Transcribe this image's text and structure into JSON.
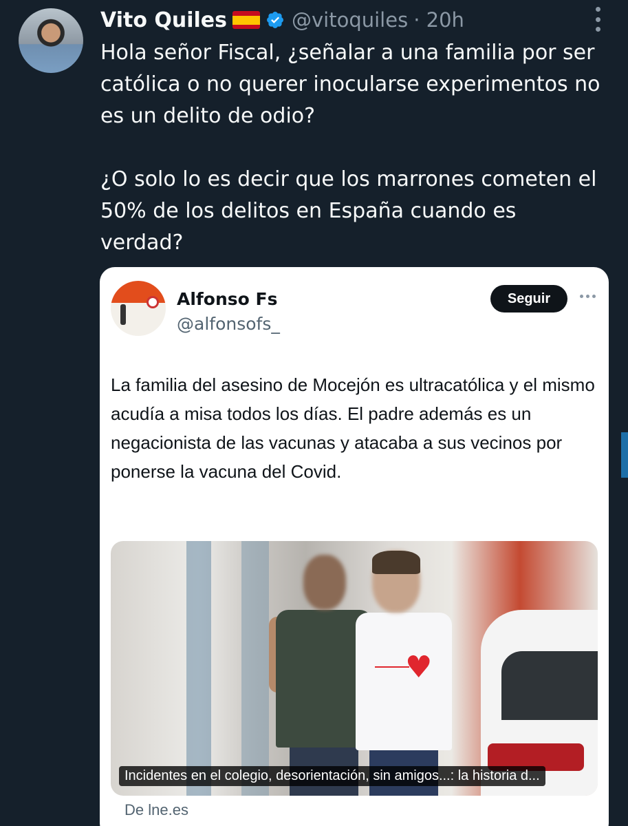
{
  "tweet": {
    "author_name": "Vito Quiles",
    "author_handle": "@vitoquiles",
    "timestamp": "· 20h",
    "text": "Hola señor Fiscal, ¿señalar a una familia por ser católica o no querer inocularse experimentos no es un delito de odio?\n\n¿O solo lo es decir que los marrones cometen el 50% de los delitos en España cuando es verdad?",
    "flag_emoji": "spain-flag"
  },
  "quoted": {
    "author_name": "Alfonso Fs",
    "author_handle": "@alfonsofs_",
    "follow_label": "Seguir",
    "text": "La familia del asesino de Mocejón es ultracatólica y el mismo acudía a misa todos los días. El padre además es un negacionista de las vacunas y atacaba a sus vecinos por ponerse la vacuna del Covid.",
    "media_caption": "Incidentes en el colegio, desorientación, sin amigos...: la historia d...",
    "source": "De lne.es"
  },
  "colors": {
    "background": "#15202b",
    "verified": "#1d9bf0",
    "follow_button": "#0f1419"
  }
}
